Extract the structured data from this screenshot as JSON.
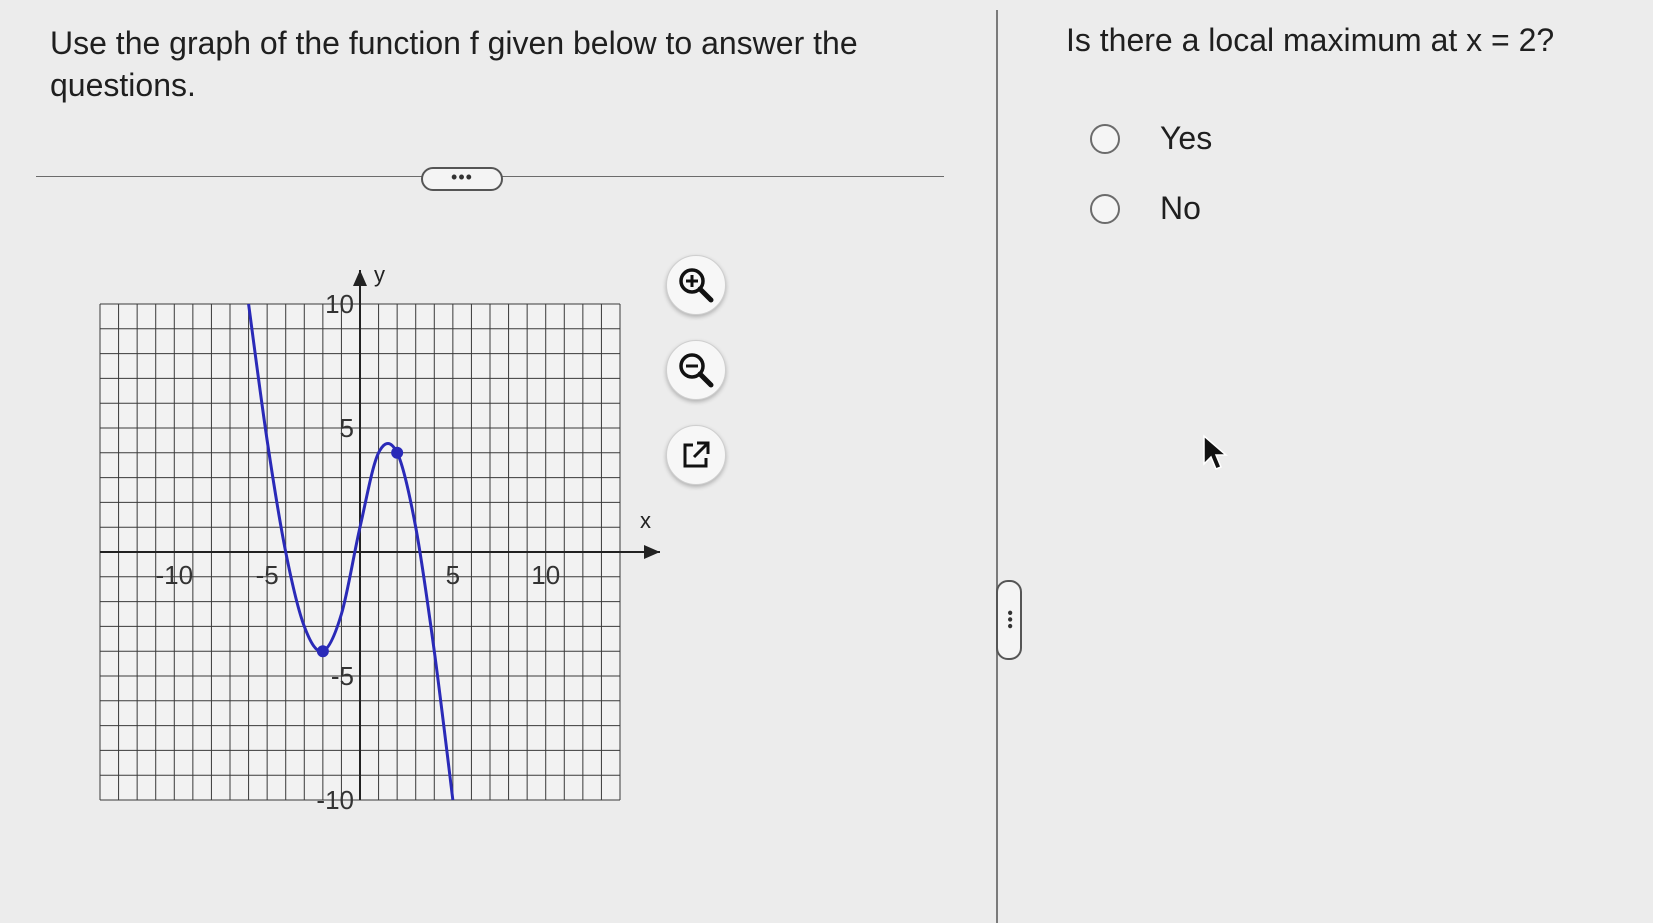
{
  "instruction": "Use the graph of the function f given below to answer the questions.",
  "expand_label": "•••",
  "question": "Is there a local maximum at x = 2?",
  "options": [
    {
      "label": "Yes"
    },
    {
      "label": "No"
    }
  ],
  "tools": [
    "zoom-in-icon",
    "zoom-out-icon",
    "external-link-icon"
  ],
  "graph": {
    "x_axis_label": "x",
    "y_axis_label": "y",
    "x_ticks": [
      {
        "value": -10,
        "label": "-10"
      },
      {
        "value": -5,
        "label": "-5"
      },
      {
        "value": 5,
        "label": "5"
      },
      {
        "value": 10,
        "label": "10"
      }
    ],
    "y_ticks": [
      {
        "value": 10,
        "label": "10"
      },
      {
        "value": 5,
        "label": "5"
      },
      {
        "value": -5,
        "label": "-5"
      },
      {
        "value": -10,
        "label": "-10"
      }
    ],
    "xlim": [
      -14,
      14
    ],
    "ylim": [
      -10,
      10
    ],
    "curve_color": "#2a2ab8",
    "grid_color": "#3a3a3a"
  },
  "chart_data": {
    "type": "line",
    "x": [
      -6,
      -5,
      -4,
      -3,
      -2,
      -1,
      0,
      1,
      2,
      3,
      4,
      5
    ],
    "series": [
      {
        "values": [
          10,
          4.5,
          0,
          -3,
          -4,
          -2.5,
          1,
          4,
          4,
          1,
          -4,
          -10
        ]
      }
    ],
    "key_points": [
      {
        "x": -2,
        "y": -4
      },
      {
        "x": 2,
        "y": 4
      }
    ],
    "xlabel": "x",
    "ylabel": "y",
    "xlim": [
      -14,
      14
    ],
    "ylim": [
      -10,
      10
    ],
    "grid": true
  }
}
